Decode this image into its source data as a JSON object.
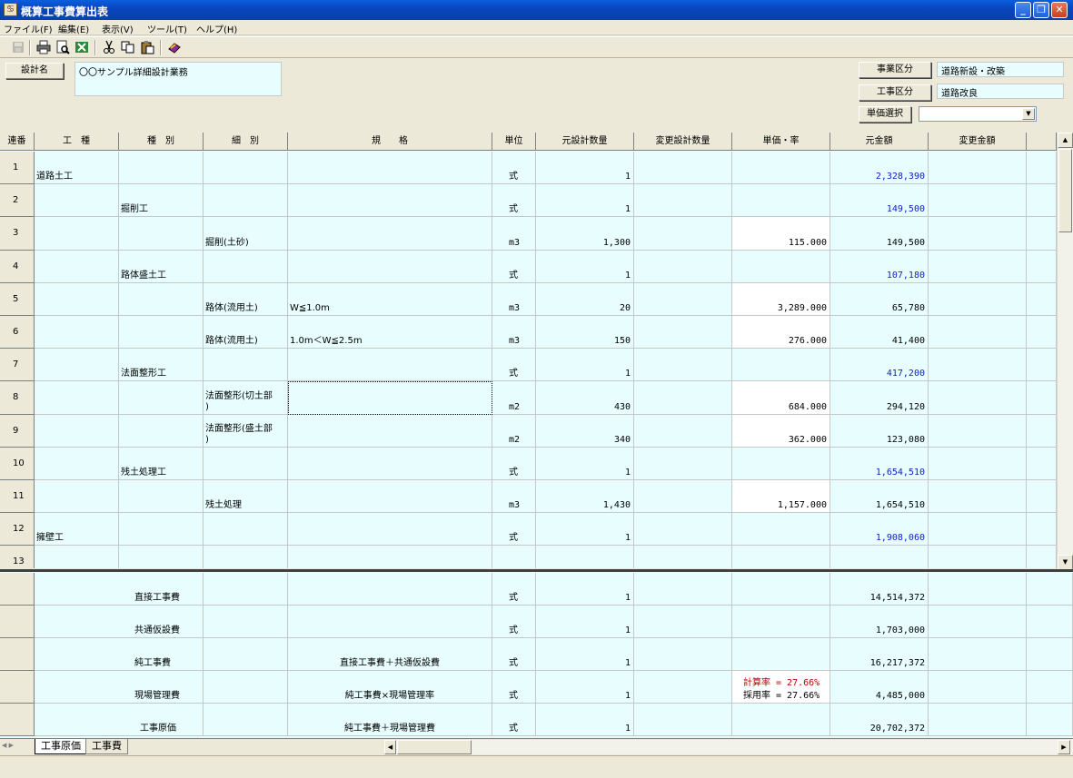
{
  "window": {
    "title": "概算工事費算出表"
  },
  "menu": [
    "ファイル(F)",
    "編集(E)",
    "表示(V)",
    "ツール(T)",
    "ヘルプ(H)"
  ],
  "toolbar": {
    "icons": [
      "save-icon",
      "print-icon",
      "print-preview-icon",
      "excel-export-icon",
      "cut-icon",
      "copy-icon",
      "paste-icon",
      "book-icon"
    ]
  },
  "header": {
    "design_name_label": "設計名",
    "design_name_value": "〇〇サンプル詳細設計業務",
    "project_class_label": "事業区分",
    "project_class_value": "道路新設・改築",
    "work_class_label": "工事区分",
    "work_class_value": "道路改良",
    "unit_price_label": "単価選択",
    "unit_price_value": ""
  },
  "columns": [
    "連番",
    "工　種",
    "種　別",
    "細　別",
    "規　　格",
    "単位",
    "元設計数量",
    "変更設計数量",
    "単価・率",
    "元金額",
    "変更金額"
  ],
  "rows": [
    {
      "no": "1",
      "koshu": "道路土工",
      "shubetsu": "",
      "saibetsu": "",
      "kikaku": "",
      "unit": "式",
      "qty": "1",
      "rate": "",
      "amount": "2,328,390",
      "rate_input": false,
      "amount_color": "blue"
    },
    {
      "no": "2",
      "koshu": "",
      "shubetsu": "掘削工",
      "saibetsu": "",
      "kikaku": "",
      "unit": "式",
      "qty": "1",
      "rate": "",
      "amount": "149,500",
      "rate_input": false,
      "amount_color": "blue"
    },
    {
      "no": "3",
      "koshu": "",
      "shubetsu": "",
      "saibetsu": "掘削(土砂)",
      "kikaku": "",
      "unit": "m3",
      "qty": "1,300",
      "rate": "115.000",
      "amount": "149,500",
      "rate_input": true,
      "amount_color": "black"
    },
    {
      "no": "4",
      "koshu": "",
      "shubetsu": "路体盛土工",
      "saibetsu": "",
      "kikaku": "",
      "unit": "式",
      "qty": "1",
      "rate": "",
      "amount": "107,180",
      "rate_input": false,
      "amount_color": "blue"
    },
    {
      "no": "5",
      "koshu": "",
      "shubetsu": "",
      "saibetsu": "路体(流用土)",
      "kikaku": "W≦1.0m",
      "unit": "m3",
      "qty": "20",
      "rate": "3,289.000",
      "amount": "65,780",
      "rate_input": true,
      "amount_color": "black"
    },
    {
      "no": "6",
      "koshu": "",
      "shubetsu": "",
      "saibetsu": "路体(流用土)",
      "kikaku": "1.0m＜W≦2.5m",
      "unit": "m3",
      "qty": "150",
      "rate": "276.000",
      "amount": "41,400",
      "rate_input": true,
      "amount_color": "black"
    },
    {
      "no": "7",
      "koshu": "",
      "shubetsu": "法面整形工",
      "saibetsu": "",
      "kikaku": "",
      "unit": "式",
      "qty": "1",
      "rate": "",
      "amount": "417,200",
      "rate_input": false,
      "amount_color": "blue"
    },
    {
      "no": "8",
      "koshu": "",
      "shubetsu": "",
      "saibetsu": "法面整形(切土部",
      "saibetsu2": ")",
      "kikaku": "",
      "unit": "m2",
      "qty": "430",
      "rate": "684.000",
      "amount": "294,120",
      "rate_input": true,
      "amount_color": "black"
    },
    {
      "no": "9",
      "koshu": "",
      "shubetsu": "",
      "saibetsu": "法面整形(盛土部",
      "saibetsu2": ")",
      "kikaku": "",
      "unit": "m2",
      "qty": "340",
      "rate": "362.000",
      "amount": "123,080",
      "rate_input": true,
      "amount_color": "black"
    },
    {
      "no": "10",
      "koshu": "",
      "shubetsu": "残土処理工",
      "saibetsu": "",
      "kikaku": "",
      "unit": "式",
      "qty": "1",
      "rate": "",
      "amount": "1,654,510",
      "rate_input": false,
      "amount_color": "blue"
    },
    {
      "no": "11",
      "koshu": "",
      "shubetsu": "",
      "saibetsu": "残土処理",
      "kikaku": "",
      "unit": "m3",
      "qty": "1,430",
      "rate": "1,157.000",
      "amount": "1,654,510",
      "rate_input": true,
      "amount_color": "black"
    },
    {
      "no": "12",
      "koshu": "擁壁工",
      "shubetsu": "",
      "saibetsu": "",
      "kikaku": "",
      "unit": "式",
      "qty": "1",
      "rate": "",
      "amount": "1,908,060",
      "rate_input": false,
      "amount_color": "blue"
    },
    {
      "no": "13",
      "koshu": "",
      "shubetsu": "",
      "saibetsu": "",
      "kikaku": "",
      "unit": "",
      "qty": "",
      "rate": "",
      "amount": "",
      "rate_input": false,
      "amount_color": "black"
    }
  ],
  "summary": [
    {
      "name": "直接工事費",
      "formula": "",
      "unit": "式",
      "qty": "1",
      "rate1": "",
      "rate2": "",
      "amount": "14,514,372"
    },
    {
      "name": "共通仮設費",
      "formula": "",
      "unit": "式",
      "qty": "1",
      "rate1": "",
      "rate2": "",
      "amount": "1,703,000"
    },
    {
      "name": "純工事費",
      "formula": "直接工事費＋共通仮設費",
      "unit": "式",
      "qty": "1",
      "rate1": "",
      "rate2": "",
      "amount": "16,217,372"
    },
    {
      "name": "現場管理費",
      "formula": "純工事費×現場管理率",
      "unit": "式",
      "qty": "1",
      "rate1": "計算率 = 27.66%",
      "rate2": "採用率 = 27.66%",
      "amount": "4,485,000"
    },
    {
      "name": "工事原価",
      "formula": "純工事費＋現場管理費",
      "unit": "式",
      "qty": "1",
      "rate1": "",
      "rate2": "",
      "amount": "20,702,372"
    }
  ],
  "tabs": [
    "工事原価",
    "工事費"
  ],
  "colors": {
    "grid_bg": "#E8FEFE",
    "subtotal_blue": "#1020C0",
    "rate_red": "#C00000"
  }
}
